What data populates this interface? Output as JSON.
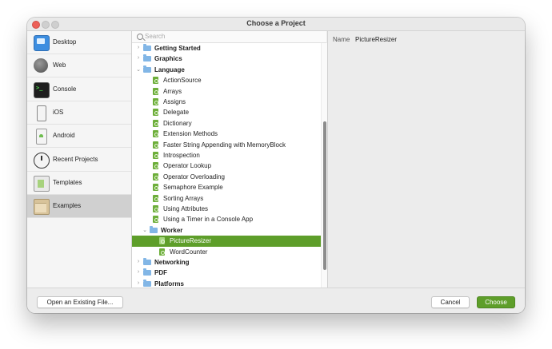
{
  "window": {
    "title": "Choose a Project"
  },
  "sidebar": {
    "items": [
      {
        "label": "Desktop",
        "icon": "desktop-icon"
      },
      {
        "label": "Web",
        "icon": "globe-icon"
      },
      {
        "label": "Console",
        "icon": "terminal-icon"
      },
      {
        "label": "iOS",
        "icon": "phone-icon"
      },
      {
        "label": "Android",
        "icon": "android-phone-icon"
      },
      {
        "label": "Recent Projects",
        "icon": "clock-icon"
      },
      {
        "label": "Templates",
        "icon": "template-icon"
      },
      {
        "label": "Examples",
        "icon": "folder-icon",
        "selected": true
      }
    ]
  },
  "search": {
    "placeholder": "Search",
    "value": ""
  },
  "tree": {
    "rows": [
      {
        "label": "Getting Started",
        "kind": "folder",
        "level": 0,
        "expanded": false
      },
      {
        "label": "Graphics",
        "kind": "folder",
        "level": 0,
        "expanded": false
      },
      {
        "label": "Language",
        "kind": "folder",
        "level": 0,
        "expanded": true
      },
      {
        "label": "ActionSource",
        "kind": "file",
        "level": 1
      },
      {
        "label": "Arrays",
        "kind": "file",
        "level": 1
      },
      {
        "label": "Assigns",
        "kind": "file",
        "level": 1
      },
      {
        "label": "Delegate",
        "kind": "file",
        "level": 1
      },
      {
        "label": "Dictionary",
        "kind": "file",
        "level": 1
      },
      {
        "label": "Extension Methods",
        "kind": "file",
        "level": 1
      },
      {
        "label": "Faster String Appending with MemoryBlock",
        "kind": "file",
        "level": 1
      },
      {
        "label": "Introspection",
        "kind": "file",
        "level": 1
      },
      {
        "label": "Operator Lookup",
        "kind": "file",
        "level": 1
      },
      {
        "label": "Operator Overloading",
        "kind": "file",
        "level": 1
      },
      {
        "label": "Semaphore Example",
        "kind": "file",
        "level": 1
      },
      {
        "label": "Sorting Arrays",
        "kind": "file",
        "level": 1
      },
      {
        "label": "Using Attributes",
        "kind": "file",
        "level": 1
      },
      {
        "label": "Using a Timer in a Console App",
        "kind": "file",
        "level": 1
      },
      {
        "label": "Worker",
        "kind": "folder",
        "level": 1,
        "expanded": true
      },
      {
        "label": "PictureResizer",
        "kind": "file",
        "level": 2,
        "selected": true
      },
      {
        "label": "WordCounter",
        "kind": "file",
        "level": 2
      },
      {
        "label": "Networking",
        "kind": "folder",
        "level": 0,
        "expanded": false
      },
      {
        "label": "PDF",
        "kind": "folder",
        "level": 0,
        "expanded": false
      },
      {
        "label": "Platforms",
        "kind": "folder",
        "level": 0,
        "expanded": false
      }
    ]
  },
  "detail": {
    "name_label": "Name",
    "name_value": "PictureResizer"
  },
  "footer": {
    "open_label": "Open an Existing File...",
    "cancel_label": "Cancel",
    "choose_label": "Choose"
  },
  "colors": {
    "accent": "#5e9e2a",
    "folder": "#82b6e6",
    "file": "#6dae3a"
  }
}
